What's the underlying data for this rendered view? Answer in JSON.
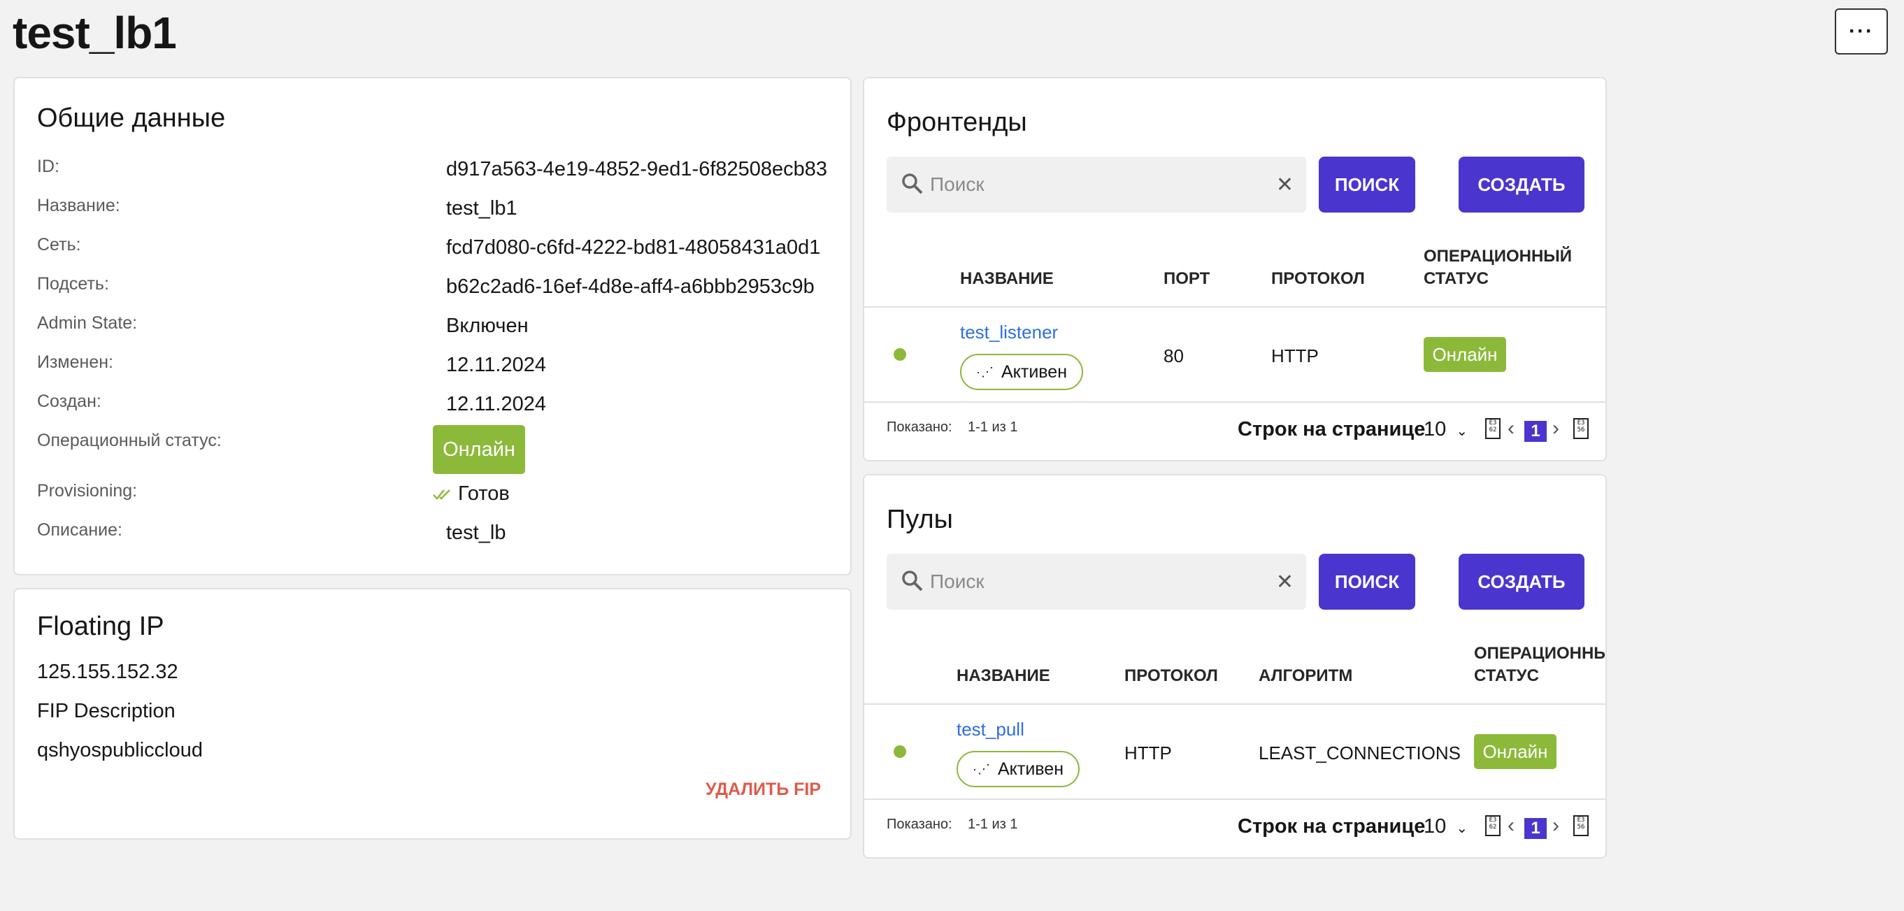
{
  "page": {
    "title": "test_lb1",
    "more_label": "···"
  },
  "general": {
    "title": "Общие данные",
    "rows": [
      {
        "label": "ID:",
        "value": "d917a563-4e19-4852-9ed1-6f82508ecb83"
      },
      {
        "label": "Название:",
        "value": "test_lb1"
      },
      {
        "label": "Сеть:",
        "value": "fcd7d080-c6fd-4222-bd81-48058431a0d1"
      },
      {
        "label": "Подсеть:",
        "value": "b62c2ad6-16ef-4d8e-aff4-a6bbb2953c9b"
      },
      {
        "label": "Admin State:",
        "value": "Включен"
      },
      {
        "label": "Изменен:",
        "value": "12.11.2024"
      },
      {
        "label": "Создан:",
        "value": "12.11.2024"
      },
      {
        "label": "Операционный статус:",
        "value": "Онлайн"
      },
      {
        "label": "Provisioning:",
        "value": "Готов"
      },
      {
        "label": "Описание:",
        "value": "test_lb"
      }
    ],
    "status_color": "#8cb93a"
  },
  "fip": {
    "title": "Floating IP",
    "address": "125.155.152.32",
    "description": "FIP Description",
    "network": "qshyospubliccloud",
    "delete_label": "УДАЛИТЬ FIP",
    "delete_color": "#e05a4a"
  },
  "frontends": {
    "title": "Фронтенды",
    "search_placeholder": "Поиск",
    "search_button": "ПОИСК",
    "create_button": "СОЗДАТЬ",
    "columns": [
      "НАЗВАНИЕ",
      "ПОРТ",
      "ПРОТОКОЛ",
      "ОПЕРАЦИОННЫЙ",
      "СТАТУС"
    ],
    "rows": [
      {
        "name": "test_listener",
        "provisioning": "Активен",
        "port": "80",
        "protocol": "HTTP",
        "status": "Онлайн"
      }
    ],
    "footer": {
      "shown_label": "Показано:",
      "shown_value": "1-1 из 1",
      "rows_label": "Строк на странице",
      "rows_value": "10",
      "page": "1"
    }
  },
  "pools": {
    "title": "Пулы",
    "search_placeholder": "Поиск",
    "search_button": "ПОИСК",
    "create_button": "СОЗДАТЬ",
    "columns": [
      "НАЗВАНИЕ",
      "ПРОТОКОЛ",
      "АЛГОРИТМ",
      "ОПЕРАЦИОННЫ",
      "СТАТУС"
    ],
    "rows": [
      {
        "name": "test_pull",
        "provisioning": "Активен",
        "protocol": "HTTP",
        "algorithm": "LEAST_CONNECTIONS",
        "status": "Онлайн"
      }
    ],
    "footer": {
      "shown_label": "Показано:",
      "shown_value": "1-1 из 1",
      "rows_label": "Строк на странице",
      "rows_value": "10",
      "page": "1"
    }
  },
  "colors": {
    "accent": "#4a35cf",
    "link": "#2d6fdf",
    "online": "#8cb93a"
  }
}
